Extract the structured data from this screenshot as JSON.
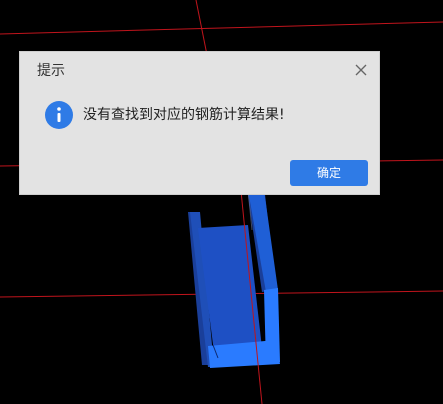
{
  "dialog": {
    "title": "提示",
    "message": "没有查找到对应的钢筋计算结果!",
    "confirm_label": "确定",
    "close_icon": "close-icon",
    "info_icon": "info-icon"
  },
  "colors": {
    "background": "#000000",
    "grid_line": "#c0141c",
    "model_blue": "#1f5fd6",
    "model_dark": "#1a3f9a",
    "dialog_bg": "#e3e3e3",
    "primary_button": "#2f7be6",
    "info_icon": "#2f7be6"
  }
}
